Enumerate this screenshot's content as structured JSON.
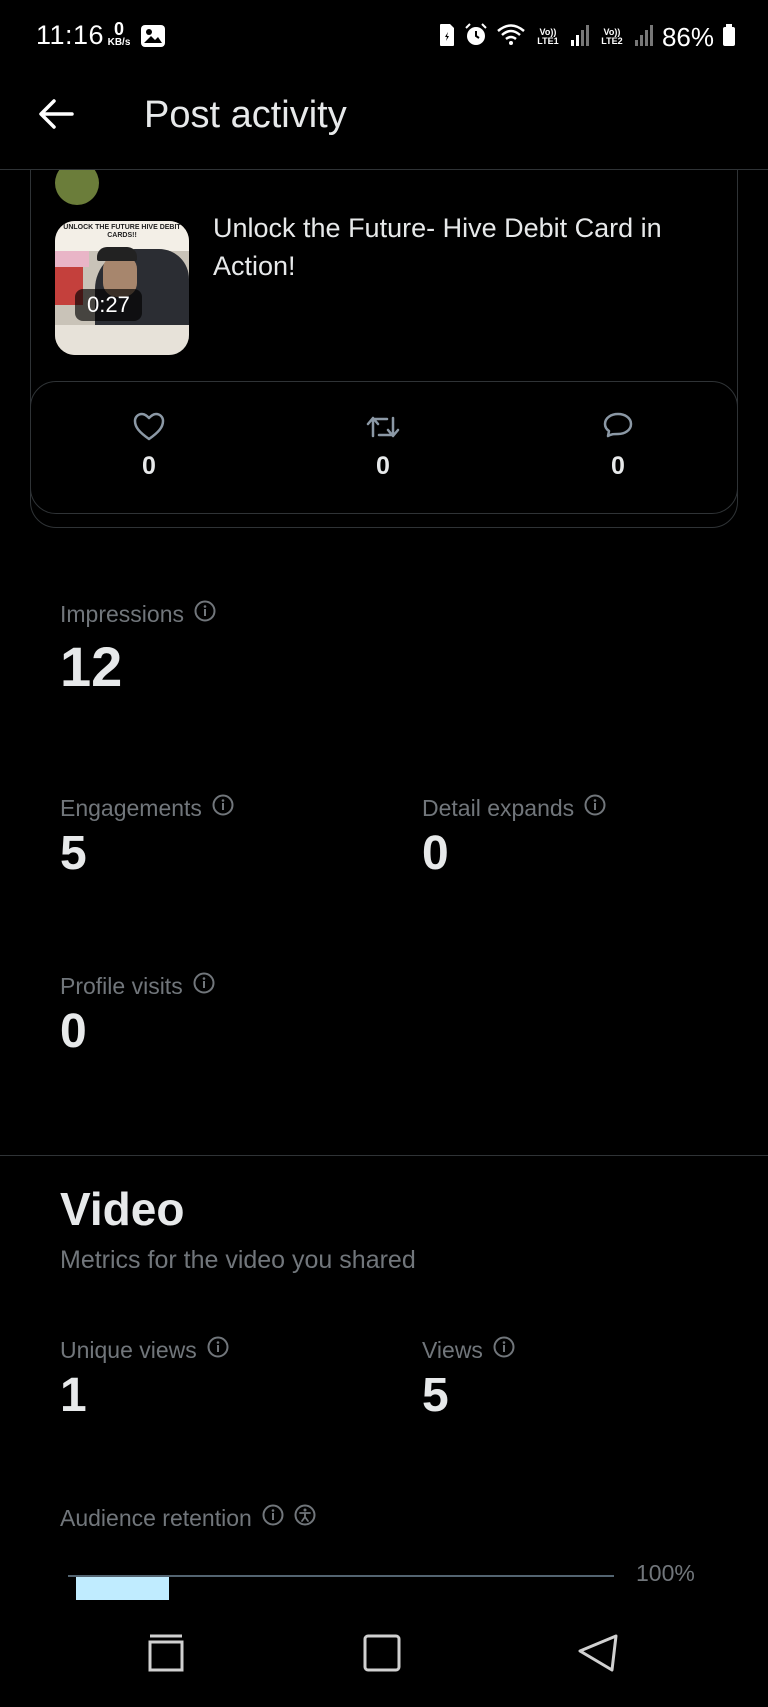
{
  "status_bar": {
    "time": "11:16",
    "net_speed_value": "0",
    "net_speed_unit": "KB/s",
    "sim1": "Vo)) LTE1",
    "sim2": "Vo)) LTE2",
    "battery": "86%"
  },
  "app_bar": {
    "title": "Post activity",
    "back_icon": "arrow-left-icon"
  },
  "post": {
    "text": "Unlock the Future- Hive Debit Card in Action!",
    "video_duration": "0:27",
    "thumb_caption": "UNLOCK THE FUTURE HIVE DEBIT CARDS!!"
  },
  "engagement_row": {
    "likes": "0",
    "reposts": "0",
    "replies": "0"
  },
  "metrics": {
    "impressions": {
      "label": "Impressions",
      "value": "12"
    },
    "engagements": {
      "label": "Engagements",
      "value": "5"
    },
    "detail_expands": {
      "label": "Detail expands",
      "value": "0"
    },
    "profile_visits": {
      "label": "Profile visits",
      "value": "0"
    }
  },
  "video": {
    "title": "Video",
    "subtitle": "Metrics for the video you shared",
    "unique_views": {
      "label": "Unique views",
      "value": "1"
    },
    "views": {
      "label": "Views",
      "value": "5"
    },
    "retention_label": "Audience retention",
    "retention_axis_max": "100%",
    "retention_first_bucket_fraction": 0.17
  },
  "colors": {
    "background": "#000000",
    "text_primary": "#e7e9ea",
    "text_secondary": "#71767b",
    "border": "#2f3336",
    "retention_bar": "#c0ecff"
  }
}
